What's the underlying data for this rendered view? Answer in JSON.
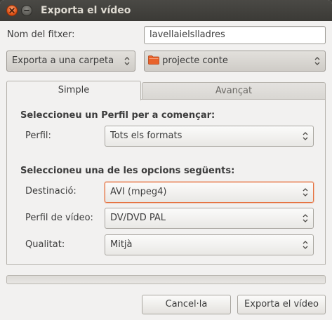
{
  "window": {
    "title": "Exporta el vídeo"
  },
  "filename": {
    "label": "Nom del fitxer:",
    "value": "lavellaielslladres"
  },
  "location": {
    "mode": "Exporta a una carpeta",
    "folder": "projecte conte"
  },
  "tabs": [
    {
      "label": "Simple"
    },
    {
      "label": "Avançat"
    }
  ],
  "profile_section": {
    "heading": "Seleccioneu un Perfil per a començar:",
    "label": "Perfil:",
    "value": "Tots els formats"
  },
  "options_section": {
    "heading": "Seleccioneu una de les opcions següents:",
    "destination": {
      "label": "Destinació:",
      "value": "AVI (mpeg4)"
    },
    "video_profile": {
      "label": "Perfil de vídeo:",
      "value": "DV/DVD PAL"
    },
    "quality": {
      "label": "Qualitat:",
      "value": "Mitjà"
    }
  },
  "progress": {
    "value": 0
  },
  "buttons": {
    "cancel": "Cancel·la",
    "export": "Exporta el vídeo"
  },
  "colors": {
    "accent": "#e6703d",
    "titlebar": "#3c3b37",
    "folder": "#e8622b"
  }
}
